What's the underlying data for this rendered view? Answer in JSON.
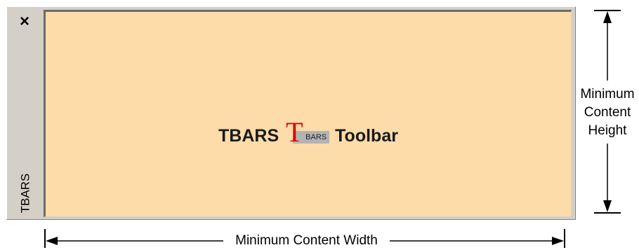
{
  "toolbar": {
    "close_glyph": "×",
    "caption": "TBARS",
    "content": {
      "prefix_text": "TBARS",
      "logo": {
        "letter": "T",
        "text": "BARS"
      },
      "suffix_text": "Toolbar"
    }
  },
  "annotations": {
    "height_label_line1": "Minimum",
    "height_label_line2": "Content",
    "height_label_line3": "Height",
    "width_label": "Minimum Content Width"
  },
  "colors": {
    "content_background": "#fddcaa",
    "window_background": "#d4d0c8",
    "logo_red": "#e10000"
  }
}
